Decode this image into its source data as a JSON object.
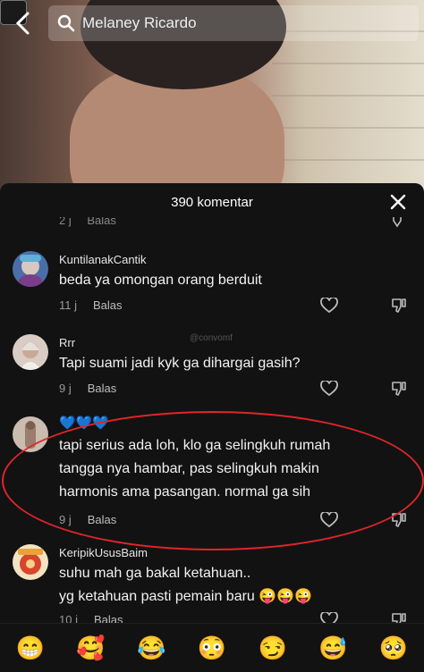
{
  "search": {
    "query": "Melaney Ricardo"
  },
  "sheet": {
    "title": "390 komentar"
  },
  "partial_row": {
    "time": "2 j",
    "reply_label": "Balas"
  },
  "watermark": "@convomf",
  "comments": [
    {
      "username": "KuntilanakCantik",
      "text": "beda ya omongan orang berduit",
      "time": "11 j",
      "reply_label": "Balas"
    },
    {
      "username": "Rrr",
      "text": "Tapi suami jadi kyk ga dihargai gasih?",
      "time": "9 j",
      "reply_label": "Balas"
    },
    {
      "username": "💙💙💙",
      "text": "tapi serius ada loh, klo ga selingkuh rumah tangga nya hambar, pas selingkuh makin harmonis ama pasangan. normal ga sih",
      "time": "9 j",
      "reply_label": "Balas"
    },
    {
      "username": "KeripikUsusBaim",
      "text_line1": "suhu mah ga bakal ketahuan..",
      "text_line2": "yg ketahuan pasti pemain baru 😜😜😜",
      "time": "10 j",
      "reply_label": "Balas"
    }
  ],
  "emoji_bar": [
    "😁",
    "🥰",
    "😂",
    "😳",
    "😏",
    "😅",
    "🥺"
  ],
  "colors": {
    "sheet_bg": "#121212",
    "highlight": "#e0252a"
  }
}
